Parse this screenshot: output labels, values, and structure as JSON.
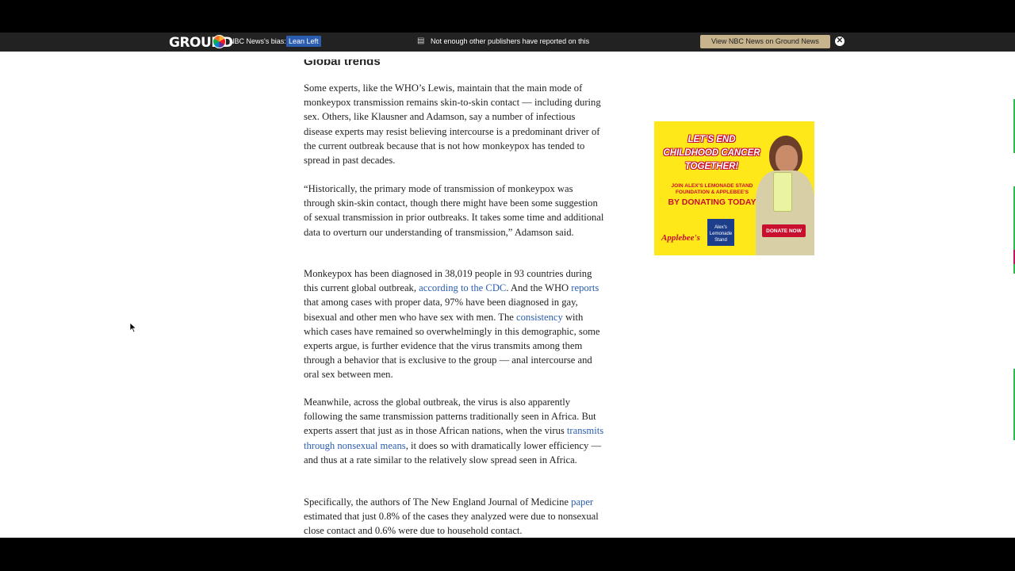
{
  "ground_news_bar": {
    "logo": "GROUND",
    "bias_label": "NBC News's bias:",
    "bias_value": "Lean Left",
    "notice": "Not enough other publishers have reported on this",
    "view_button": "View NBC News on Ground News",
    "close_symbol": "✕"
  },
  "article": {
    "section_heading": "Global trends",
    "paragraphs": [
      {
        "text": "Some experts, like the WHO’s Lewis, maintain that the main mode of monkeypox transmission remains skin-to-skin contact — including during sex. Others, like Klausner and Adamson, say a number of infectious disease experts may resist believing intercourse is a predominant driver of the current outbreak because that is not how monkeypox has tended to spread in past decades."
      },
      {
        "text": "“Historically, the primary mode of transmission of monkeypox was through skin-skin contact, though there might have been some suggestion of sexual transmission in prior outbreaks. It takes some time and additional data to overturn our understanding of transmission,” Adamson said."
      },
      {
        "t1": "Monkeypox has been diagnosed in 38,019 people in 93 countries during this current global outbreak, ",
        "link1": "according to the CDC",
        "t2": ". And the WHO ",
        "link2": "reports",
        "t3": " that among cases with proper data, 97% have been diagnosed in gay, bisexual and other men who have sex with men. The ",
        "link3": "consistency",
        "t4": " with which cases have remained so overwhelmingly in this demographic, some experts argue, is further evidence that the virus transmits among them through a behavior that is exclusive to the group — anal intercourse and oral sex between men."
      },
      {
        "t1": "Meanwhile, across the global outbreak, the virus is also apparently following the same transmission patterns traditionally seen in Africa. But experts assert that just as in those African nations, when the virus ",
        "link1": "transmits through nonsexual means",
        "t2": ", it does so with dramatically lower efficiency — and thus at a rate similar to the relatively slow spread seen in Africa."
      },
      {
        "t1": "Specifically, the authors of The New England Journal of Medicine ",
        "link1": "paper",
        "t2": " estimated that just 0.8% of the cases they analyzed were due to nonsexual close contact and 0.6% were due to household contact."
      }
    ]
  },
  "ad": {
    "headline": "LET’S END CHILDHOOD CANCER TOGETHER!",
    "subline": "JOIN ALEX’S LEMONADE STAND FOUNDATION & APPLEBEE’S",
    "cta_text": "BY DONATING TODAY",
    "donate_button": "DONATE NOW",
    "sponsor": "Applebee's",
    "partner": "Alex's Lemonade Stand",
    "colors": {
      "background": "#ffe81a",
      "accent": "#c8102e"
    }
  },
  "colors": {
    "link": "#2a5db0",
    "topbar": "#222222",
    "bias_highlight": "#2a5db0",
    "view_button": "#c7b48d"
  }
}
